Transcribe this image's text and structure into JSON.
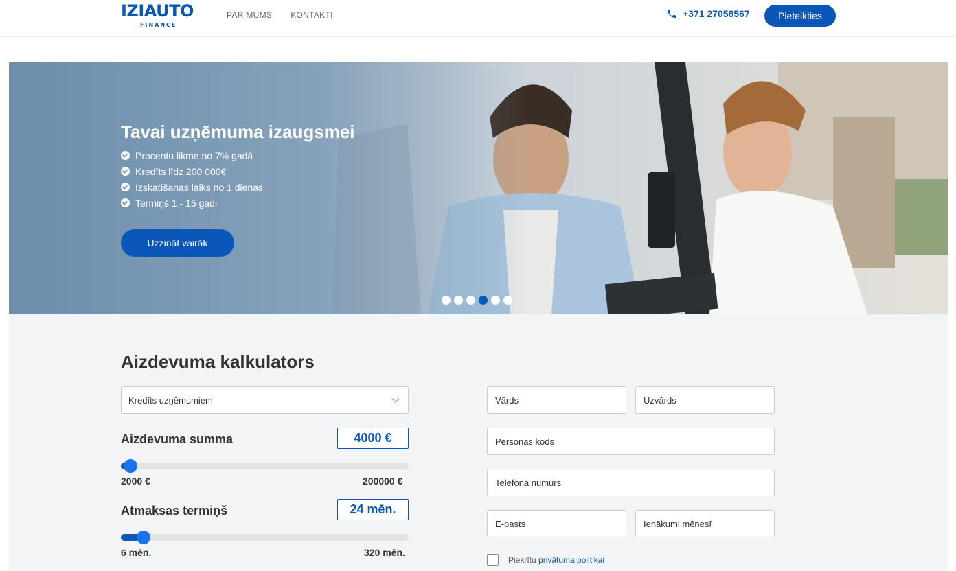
{
  "header": {
    "logo_main": "IZIAUTO",
    "logo_sub": "FINANCE",
    "nav": [
      "PAR MUMS",
      "KONTAKTI"
    ],
    "phone": "+371 27058567",
    "apply_button": "Pieteikties"
  },
  "hero": {
    "title": "Tavai uzņēmuma izaugsmei",
    "bullets": [
      "Procentu likme no 7% gadā",
      "Kredīts līdz 200 000€",
      "Izskatīšanas laiks no 1 dienas",
      "Termiņš 1 - 15 gadi"
    ],
    "cta": "Uzzināt vairāk",
    "slides_total": 6,
    "active_slide": 4
  },
  "calculator": {
    "title": "Aizdevuma kalkulators",
    "loan_type": "Kredīts uzņēmumiem",
    "amount": {
      "label": "Aizdevuma summa",
      "value": "4000 €",
      "min": "2000 €",
      "max": "200000 €",
      "fraction": 0.01
    },
    "term": {
      "label": "Atmaksas termiņš",
      "value": "24 mēn.",
      "min": "6 mēn.",
      "max": "320 mēn.",
      "fraction": 0.057
    }
  },
  "form": {
    "first_name": "Vārds",
    "last_name": "Uzvārds",
    "personal_code": "Personas kods",
    "phone": "Telefona numurs",
    "email": "E-pasts",
    "income": "Ienākumi mēnesī",
    "consent_prefix": "Piekrītu",
    "consent_link": "privātuma politikai"
  },
  "colors": {
    "brand": "#0b56b9",
    "section_bg": "#f3f4f6"
  }
}
